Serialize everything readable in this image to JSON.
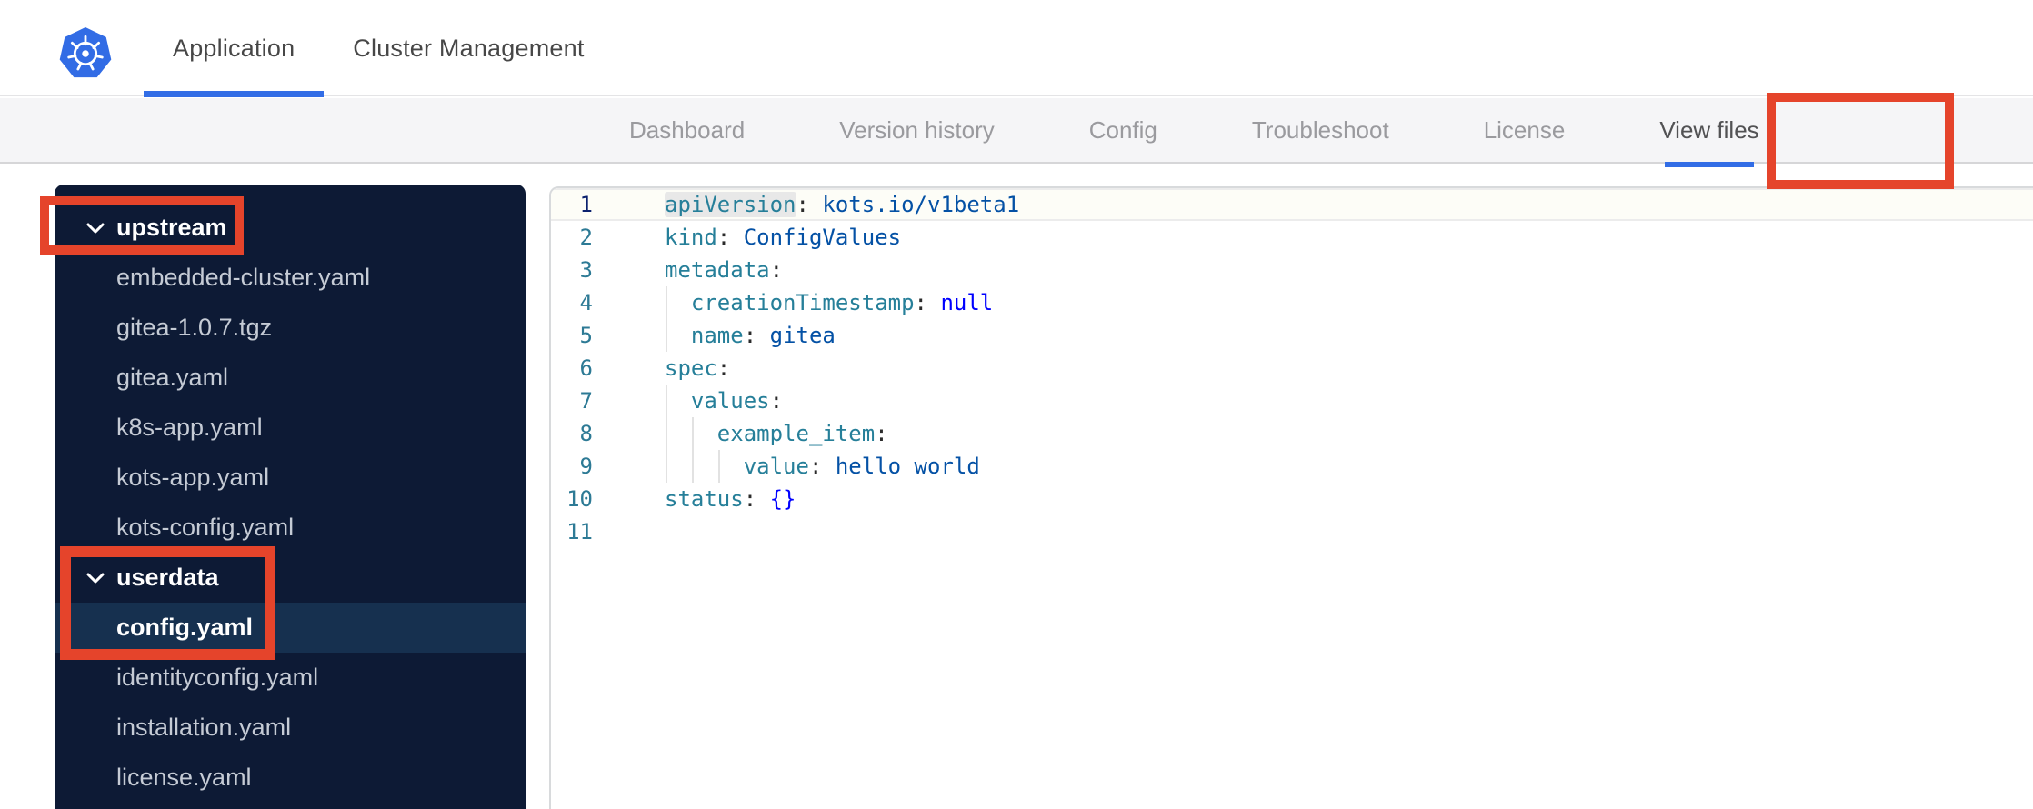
{
  "header": {
    "tabs": [
      {
        "label": "Application",
        "active": true
      },
      {
        "label": "Cluster Management",
        "active": false
      }
    ]
  },
  "subnav": {
    "tabs": [
      {
        "label": "Dashboard",
        "active": false
      },
      {
        "label": "Version history",
        "active": false
      },
      {
        "label": "Config",
        "active": false
      },
      {
        "label": "Troubleshoot",
        "active": false
      },
      {
        "label": "License",
        "active": false
      },
      {
        "label": "View files",
        "active": true
      }
    ]
  },
  "file_tree": {
    "items": [
      {
        "type": "folder",
        "label": "upstream",
        "expanded": true
      },
      {
        "type": "file",
        "label": "embedded-cluster.yaml"
      },
      {
        "type": "file",
        "label": "gitea-1.0.7.tgz"
      },
      {
        "type": "file",
        "label": "gitea.yaml"
      },
      {
        "type": "file",
        "label": "k8s-app.yaml"
      },
      {
        "type": "file",
        "label": "kots-app.yaml"
      },
      {
        "type": "file",
        "label": "kots-config.yaml"
      },
      {
        "type": "folder",
        "label": "userdata",
        "expanded": true
      },
      {
        "type": "file",
        "label": "config.yaml",
        "selected": true
      },
      {
        "type": "file",
        "label": "identityconfig.yaml"
      },
      {
        "type": "file",
        "label": "installation.yaml"
      },
      {
        "type": "file",
        "label": "license.yaml"
      }
    ]
  },
  "editor": {
    "lines": [
      {
        "n": 1,
        "indent": 0,
        "active": true,
        "tokens": [
          {
            "c": "key",
            "t": "apiVersion",
            "hl": true
          },
          {
            "c": "punc",
            "t": ":"
          },
          {
            "c": "plain",
            "t": " "
          },
          {
            "c": "str",
            "t": "kots.io/v1beta1"
          }
        ]
      },
      {
        "n": 2,
        "indent": 0,
        "tokens": [
          {
            "c": "key",
            "t": "kind"
          },
          {
            "c": "punc",
            "t": ":"
          },
          {
            "c": "plain",
            "t": " "
          },
          {
            "c": "str",
            "t": "ConfigValues"
          }
        ]
      },
      {
        "n": 3,
        "indent": 0,
        "tokens": [
          {
            "c": "key",
            "t": "metadata"
          },
          {
            "c": "punc",
            "t": ":"
          }
        ]
      },
      {
        "n": 4,
        "indent": 2,
        "tokens": [
          {
            "c": "key",
            "t": "creationTimestamp"
          },
          {
            "c": "punc",
            "t": ":"
          },
          {
            "c": "plain",
            "t": " "
          },
          {
            "c": "kw",
            "t": "null"
          }
        ]
      },
      {
        "n": 5,
        "indent": 2,
        "tokens": [
          {
            "c": "key",
            "t": "name"
          },
          {
            "c": "punc",
            "t": ":"
          },
          {
            "c": "plain",
            "t": " "
          },
          {
            "c": "str",
            "t": "gitea"
          }
        ]
      },
      {
        "n": 6,
        "indent": 0,
        "tokens": [
          {
            "c": "key",
            "t": "spec"
          },
          {
            "c": "punc",
            "t": ":"
          }
        ]
      },
      {
        "n": 7,
        "indent": 2,
        "tokens": [
          {
            "c": "key",
            "t": "values"
          },
          {
            "c": "punc",
            "t": ":"
          }
        ]
      },
      {
        "n": 8,
        "indent": 4,
        "tokens": [
          {
            "c": "key",
            "t": "example_item"
          },
          {
            "c": "punc",
            "t": ":"
          }
        ]
      },
      {
        "n": 9,
        "indent": 6,
        "tokens": [
          {
            "c": "key",
            "t": "value"
          },
          {
            "c": "punc",
            "t": ":"
          },
          {
            "c": "plain",
            "t": " "
          },
          {
            "c": "str",
            "t": "hello world"
          }
        ]
      },
      {
        "n": 10,
        "indent": 0,
        "tokens": [
          {
            "c": "key",
            "t": "status"
          },
          {
            "c": "punc",
            "t": ":"
          },
          {
            "c": "plain",
            "t": " "
          },
          {
            "c": "kw",
            "t": "{}"
          }
        ]
      },
      {
        "n": 11,
        "indent": 0,
        "tokens": []
      }
    ]
  },
  "annotations": {
    "color": "#e5442b",
    "targets": [
      "upstream-folder",
      "userdata-config-files",
      "view-files-tab"
    ]
  },
  "colors": {
    "accent_blue": "#326de6",
    "logo_blue": "#326ce5",
    "annotation_red": "#e5442b",
    "sidebar_bg": "#0d1a35",
    "sidebar_selected_bg": "#16304f",
    "code_key": "#267f99",
    "code_string": "#0451a5",
    "code_keyword": "#0000ff",
    "line_number": "#2d7a95",
    "active_line_number": "#0b216f"
  }
}
